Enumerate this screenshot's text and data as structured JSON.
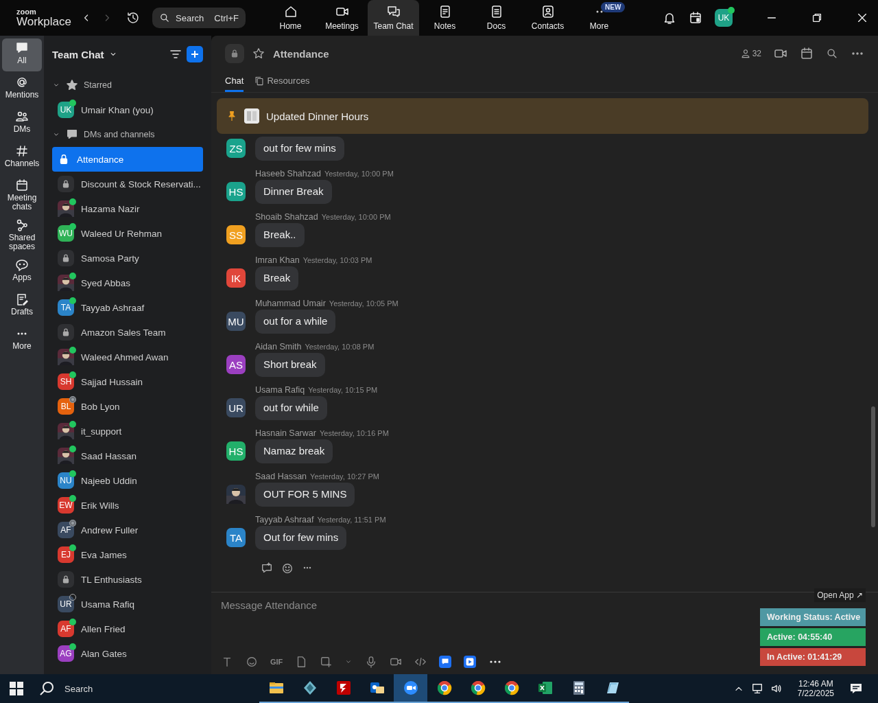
{
  "titlebar": {
    "logo_top": "zoom",
    "logo_bottom": "Workplace",
    "search": {
      "placeholder": "Search",
      "shortcut": "Ctrl+F"
    },
    "nav": [
      {
        "label": "Home",
        "selected": false
      },
      {
        "label": "Meetings",
        "selected": false
      },
      {
        "label": "Team Chat",
        "selected": true
      },
      {
        "label": "Notes",
        "selected": false
      },
      {
        "label": "Docs",
        "selected": false
      },
      {
        "label": "Contacts",
        "selected": false
      },
      {
        "label": "More",
        "selected": false,
        "badge": "NEW"
      }
    ],
    "avatar": {
      "initials": "UK",
      "color": "#1fa287",
      "online": true
    }
  },
  "rail": [
    {
      "label": "All",
      "selected": true
    },
    {
      "label": "Mentions",
      "selected": false
    },
    {
      "label": "DMs",
      "selected": false
    },
    {
      "label": "Channels",
      "selected": false
    },
    {
      "label": "Meeting chats",
      "selected": false
    },
    {
      "label": "Shared spaces",
      "selected": false
    },
    {
      "label": "Apps",
      "selected": false
    },
    {
      "label": "Drafts",
      "selected": false
    },
    {
      "label": "More",
      "selected": false
    }
  ],
  "sidebar": {
    "title": "Team Chat",
    "sections": [
      {
        "label": "Starred",
        "expanded": true,
        "items": [
          {
            "name": "Umair Khan (you)",
            "kind": "initials",
            "initials": "UK",
            "color": "#1fa287",
            "online": true,
            "away": false,
            "selected": false
          }
        ]
      },
      {
        "label": "DMs and channels",
        "expanded": true,
        "items": [
          {
            "name": "Attendance",
            "kind": "channel",
            "selected": true
          },
          {
            "name": "Discount & Stock Reservati...",
            "kind": "channel",
            "selected": false
          },
          {
            "name": "Hazama Nazir",
            "online": true,
            "away": false,
            "selected": false
          },
          {
            "name": "Waleed Ur Rehman",
            "kind": "initials",
            "initials": "WU",
            "color": "#2fb257",
            "online": true,
            "away": false,
            "selected": false
          },
          {
            "name": "Samosa Party",
            "kind": "channel",
            "selected": false
          },
          {
            "name": "Syed Abbas",
            "online": true,
            "away": false,
            "selected": false
          },
          {
            "name": "Tayyab Ashraaf",
            "kind": "initials",
            "initials": "TA",
            "color": "#2b84c8",
            "online": true,
            "away": false,
            "selected": false
          },
          {
            "name": "Amazon Sales Team",
            "kind": "channel",
            "selected": false
          },
          {
            "name": "Waleed Ahmed Awan",
            "online": true,
            "away": false,
            "selected": false
          },
          {
            "name": "Sajjad Hussain",
            "kind": "initials",
            "initials": "SH",
            "color": "#d8392f",
            "online": true,
            "away": false,
            "selected": false
          },
          {
            "name": "Bob Lyon",
            "kind": "initials",
            "initials": "BL",
            "color": "#e5620e",
            "online": false,
            "away": true,
            "selected": false
          },
          {
            "name": "it_support",
            "online": true,
            "away": false,
            "selected": false
          },
          {
            "name": "Saad Hassan",
            "online": true,
            "away": false,
            "selected": false
          },
          {
            "name": "Najeeb Uddin",
            "kind": "initials",
            "initials": "NU",
            "color": "#2b84c8",
            "online": true,
            "away": false,
            "selected": false
          },
          {
            "name": "Erik Wills",
            "kind": "initials",
            "initials": "EW",
            "color": "#d8392f",
            "online": true,
            "away": false,
            "selected": false
          },
          {
            "name": "Andrew Fuller",
            "kind": "initials",
            "initials": "AF",
            "color": "#3a4a60",
            "online": false,
            "away": true,
            "selected": false
          },
          {
            "name": "Eva James",
            "kind": "initials",
            "initials": "EJ",
            "color": "#d8392f",
            "online": true,
            "away": false,
            "selected": false
          },
          {
            "name": "TL Enthusiasts",
            "kind": "channel",
            "selected": false
          },
          {
            "name": "Usama Rafiq",
            "kind": "initials",
            "initials": "UR",
            "color": "#3a4a60",
            "online": false,
            "away": false,
            "selected": false
          },
          {
            "name": "Allen Fried",
            "kind": "initials",
            "initials": "AF",
            "color": "#d8392f",
            "online": true,
            "away": false,
            "selected": false
          },
          {
            "name": "Alan Gates",
            "kind": "initials",
            "initials": "AG",
            "color": "#9b3fc0",
            "online": true,
            "away": false,
            "selected": false
          }
        ]
      }
    ]
  },
  "channel": {
    "title": "Attendance",
    "members": "32",
    "tabs": [
      {
        "label": "Chat",
        "selected": true
      },
      {
        "label": "Resources",
        "selected": false
      }
    ],
    "pinned": "Updated Dinner Hours",
    "messages": [
      {
        "kind": "initials",
        "initials": "ZS",
        "color": "#1aa38c",
        "text": "out for few mins"
      },
      {
        "kind": "initials",
        "initials": "HS",
        "color": "#1aa38c",
        "author": "Haseeb Shahzad",
        "time": "Yesterday, 10:00 PM",
        "text": "Dinner Break"
      },
      {
        "kind": "initials",
        "initials": "SS",
        "color": "#f0a020",
        "author": "Shoaib Shahzad",
        "time": "Yesterday, 10:00 PM",
        "text": "Break.."
      },
      {
        "kind": "initials",
        "initials": "IK",
        "color": "#e0463a",
        "author": "Imran Khan",
        "time": "Yesterday, 10:03 PM",
        "text": "Break"
      },
      {
        "kind": "initials",
        "initials": "MU",
        "color": "#3a4a60",
        "author": "Muhammad Umair",
        "time": "Yesterday, 10:05 PM",
        "text": "out for a while"
      },
      {
        "kind": "initials",
        "initials": "AS",
        "color": "#9b3fc0",
        "author": "Aidan Smith",
        "time": "Yesterday, 10:08 PM",
        "text": "Short break"
      },
      {
        "kind": "initials",
        "initials": "UR",
        "color": "#3a4a60",
        "author": "Usama Rafiq",
        "time": "Yesterday, 10:15 PM",
        "text": "out for while"
      },
      {
        "kind": "initials",
        "initials": "HS",
        "color": "#22b06a",
        "author": "Hasnain Sarwar",
        "time": "Yesterday, 10:16 PM",
        "text": "Namaz break"
      },
      {
        "author": "Saad Hassan",
        "time": "Yesterday, 10:27 PM",
        "text": "OUT FOR 5 MINS"
      },
      {
        "kind": "initials",
        "initials": "TA",
        "color": "#2b84c8",
        "author": "Tayyab Ashraaf",
        "time": "Yesterday, 11:51 PM",
        "text": "Out for few mins",
        "actions": true
      }
    ],
    "composer": {
      "placeholder": "Message Attendance",
      "gif": "GIF"
    }
  },
  "status_widget": {
    "link": "Open App ↗",
    "rows": [
      {
        "text": "Working Status: Active",
        "color": "#4f98a3"
      },
      {
        "text": "Active: 04:55:40",
        "color": "#27a461"
      },
      {
        "text": "In Active: 01:41:29",
        "color": "#c8473d"
      }
    ]
  },
  "taskbar": {
    "search": "Search",
    "time": "12:46 AM",
    "date": "7/22/2025",
    "apps": [
      {
        "kind": "folder",
        "selected": false
      },
      {
        "kind": "diamond",
        "selected": false
      },
      {
        "kind": "ftp",
        "selected": false
      },
      {
        "kind": "mail",
        "selected": false
      },
      {
        "kind": "zoom",
        "selected": true
      },
      {
        "kind": "browser",
        "selected": false
      },
      {
        "kind": "browser",
        "selected": false
      },
      {
        "kind": "browser",
        "selected": false
      },
      {
        "kind": "sheet",
        "selected": false
      },
      {
        "kind": "calculator",
        "selected": false
      },
      {
        "kind": "notepad",
        "selected": false
      }
    ]
  }
}
